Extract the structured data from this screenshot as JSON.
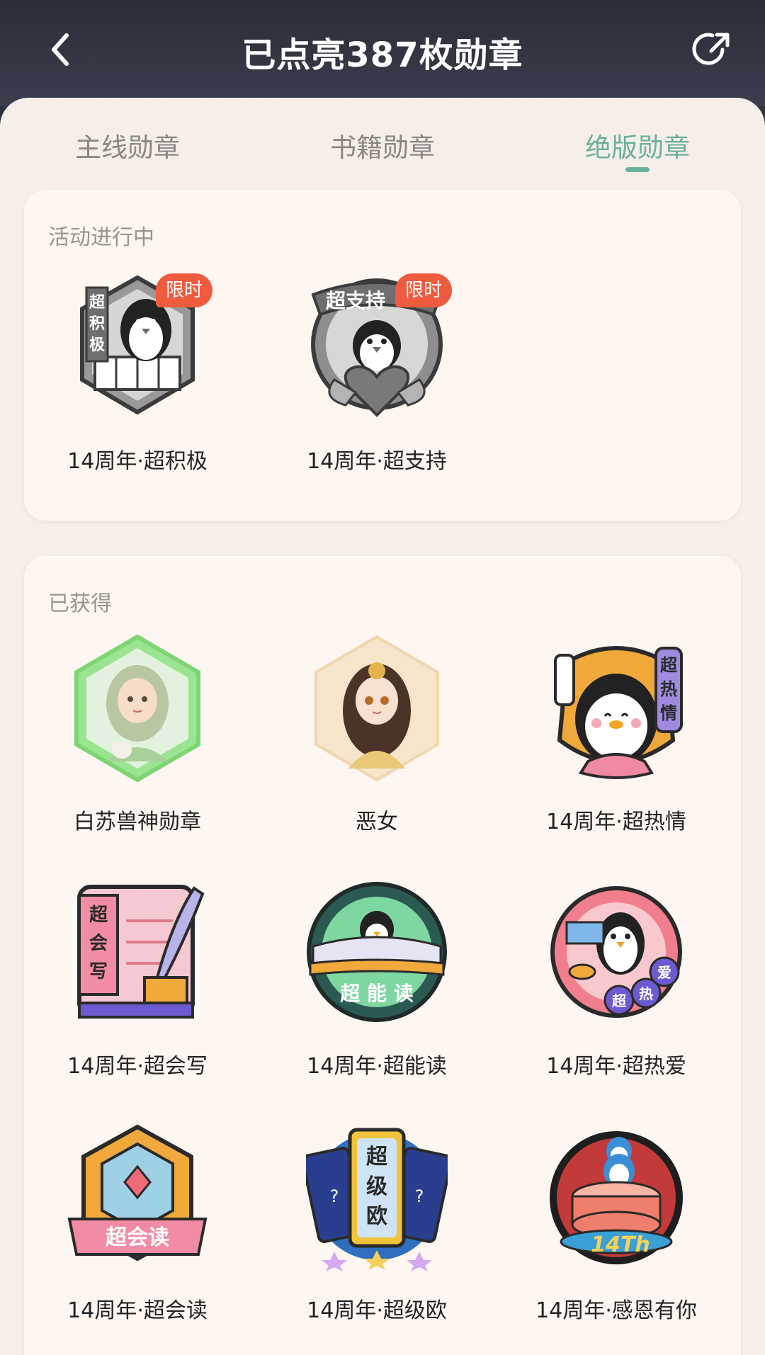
{
  "header": {
    "title": "已点亮387枚勋章",
    "back_icon": "chevron-left-icon",
    "share_icon": "share-icon"
  },
  "tabs": [
    {
      "label": "主线勋章",
      "active": false
    },
    {
      "label": "书籍勋章",
      "active": false
    },
    {
      "label": "绝版勋章",
      "active": true
    }
  ],
  "sections": {
    "ongoing": {
      "title": "活动进行中",
      "items": [
        {
          "label": "14周年·超积极",
          "tag": "限时",
          "art_text": "超积极"
        },
        {
          "label": "14周年·超支持",
          "tag": "限时",
          "art_text": "超支持"
        }
      ]
    },
    "obtained": {
      "title": "已获得",
      "items": [
        {
          "label": "白苏兽神勋章"
        },
        {
          "label": "恶女"
        },
        {
          "label": "14周年·超热情",
          "art_text": "超热情"
        },
        {
          "label": "14周年·超会写",
          "art_text": "超会写"
        },
        {
          "label": "14周年·超能读",
          "art_text": "超能读"
        },
        {
          "label": "14周年·超热爱",
          "art_text": "超热爱"
        },
        {
          "label": "14周年·超会读",
          "art_text": "超会读"
        },
        {
          "label": "14周年·超级欧",
          "art_text": "超级欧"
        },
        {
          "label": "14周年·感恩有你",
          "art_text": "14Th"
        }
      ]
    }
  },
  "colors": {
    "header_bg": "#2f3240",
    "sheet_bg": "#f6efe9",
    "active_tab": "#6bb09a",
    "limited_tag": "#ef5b3e"
  }
}
